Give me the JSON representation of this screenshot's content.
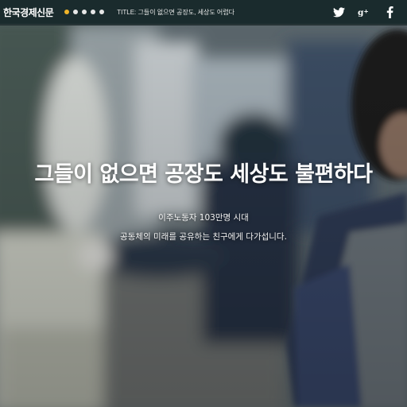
{
  "header": {
    "brand": "한국경제신문",
    "dots": [
      {
        "state": "active"
      },
      {
        "state": "inactive"
      },
      {
        "state": "inactive"
      },
      {
        "state": "inactive"
      },
      {
        "state": "inactive"
      }
    ],
    "title_text": "TITLE: 그들이 없으면 공장도, 세상도 어렵다",
    "social": [
      "twitter-icon",
      "google-plus-icon",
      "facebook-icon"
    ]
  },
  "hero": {
    "headline": "그들이 없으면 공장도 세상도 불편하다",
    "subtitle_line1": "이주노동자 103만명 시대",
    "subtitle_line2": "공동체의 미래를 공유하는 친구에게 다가섭니다."
  },
  "colors": {
    "topbar_bg": "#1a2b2d",
    "dot_active": "#f0b429",
    "dot_inactive": "#e6e6e6",
    "text": "#ffffff"
  }
}
